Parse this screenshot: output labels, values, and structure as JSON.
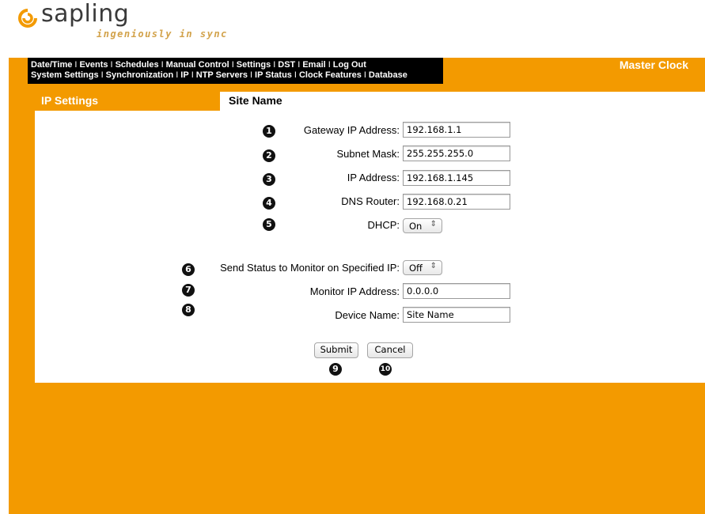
{
  "logo": {
    "word": "sapling",
    "tagline": "ingeniously in sync"
  },
  "nav": {
    "row1": [
      "Date/Time",
      "Events",
      "Schedules",
      "Manual Control",
      "Settings",
      "DST",
      "Email",
      "Log Out"
    ],
    "row2": [
      "System Settings",
      "Synchronization",
      "IP",
      "NTP Servers",
      "IP Status",
      "Clock Features",
      "Database"
    ],
    "separator": "I"
  },
  "header": {
    "master_clock": "Master Clock",
    "section": "IP Settings",
    "site_name": "Site Name"
  },
  "form": {
    "gateway": {
      "num": "1",
      "label": "Gateway IP Address:",
      "value": "192.168.1.1"
    },
    "subnet": {
      "num": "2",
      "label": "Subnet Mask:",
      "value": "255.255.255.0"
    },
    "ip": {
      "num": "3",
      "label": "IP Address:",
      "value": "192.168.1.145"
    },
    "dns": {
      "num": "4",
      "label": "DNS Router:",
      "value": "192.168.0.21"
    },
    "dhcp": {
      "num": "5",
      "label": "DHCP:",
      "value": "On"
    },
    "send_status": {
      "num": "6",
      "label": "Send Status to Monitor on Specified IP:",
      "value": "Off"
    },
    "monitor_ip": {
      "num": "7",
      "label": "Monitor IP Address:",
      "value": "0.0.0.0"
    },
    "device_name": {
      "num": "8",
      "label": "Device Name:",
      "value": "Site Name"
    },
    "submit": {
      "num": "9",
      "label": "Submit"
    },
    "cancel": {
      "num": "10",
      "label": "Cancel"
    }
  },
  "colors": {
    "orange": "#f39a00",
    "menu_bg": "#000000",
    "tagline": "#d2a24a"
  }
}
